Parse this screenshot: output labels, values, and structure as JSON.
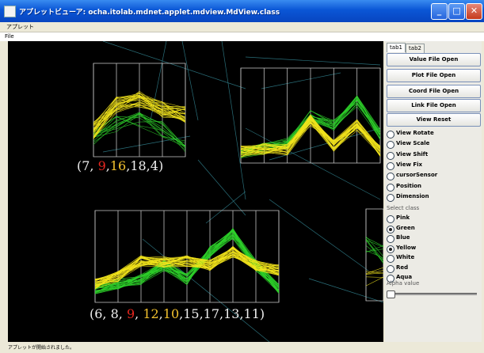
{
  "window": {
    "title": "アプレットビューア: ocha.itolab.mdnet.applet.mdview.MdView.class"
  },
  "menubar": {
    "applet_menu": "アプレット"
  },
  "filebar": {
    "file_menu": "File"
  },
  "canvas": {
    "sequences": [
      {
        "parts": [
          {
            "text": "(7, ",
            "c": "w"
          },
          {
            "text": "9",
            "c": "r"
          },
          {
            "text": ",",
            "c": "w"
          },
          {
            "text": "16",
            "c": "y"
          },
          {
            "text": ",18,4)",
            "c": "w"
          }
        ]
      },
      {
        "parts": [
          {
            "text": "(6, 8, ",
            "c": "w"
          },
          {
            "text": "9",
            "c": "r"
          },
          {
            "text": ", ",
            "c": "w"
          },
          {
            "text": "12",
            "c": "y"
          },
          {
            "text": ",",
            "c": "w"
          },
          {
            "text": "10",
            "c": "y"
          },
          {
            "text": ",15,17,13,11)",
            "c": "w"
          }
        ]
      }
    ]
  },
  "panel": {
    "tabs": [
      "tab1",
      "tab2"
    ],
    "buttons": [
      "Value File Open",
      "Plot File Open",
      "Coord File Open",
      "Link File Open",
      "View Reset"
    ],
    "modes": [
      {
        "label": "View Rotate",
        "on": false
      },
      {
        "label": "View Scale",
        "on": false
      },
      {
        "label": "View Shift",
        "on": false
      },
      {
        "label": "View Fix",
        "on": false
      },
      {
        "label": "cursorSensor",
        "on": false
      },
      {
        "label": "Position",
        "on": false
      },
      {
        "label": "Dimension",
        "on": false
      }
    ],
    "select_class_label": "Select class",
    "classes": [
      {
        "label": "Pink",
        "on": false
      },
      {
        "label": "Green",
        "on": true
      },
      {
        "label": "Blue",
        "on": false
      },
      {
        "label": "Yellow",
        "on": true
      },
      {
        "label": "White",
        "on": false
      },
      {
        "label": "Red",
        "on": false
      },
      {
        "label": "Aqua",
        "on": false
      }
    ],
    "alpha_label": "Alpha value",
    "alpha_value": 0
  },
  "status": {
    "text": "アプレットが開始されました。"
  },
  "colors": {
    "titlebar": "#0a56d6",
    "yellow_lines": "#f5e61c",
    "green_lines": "#2ed12a",
    "teal_links": "#2a6f7a"
  }
}
